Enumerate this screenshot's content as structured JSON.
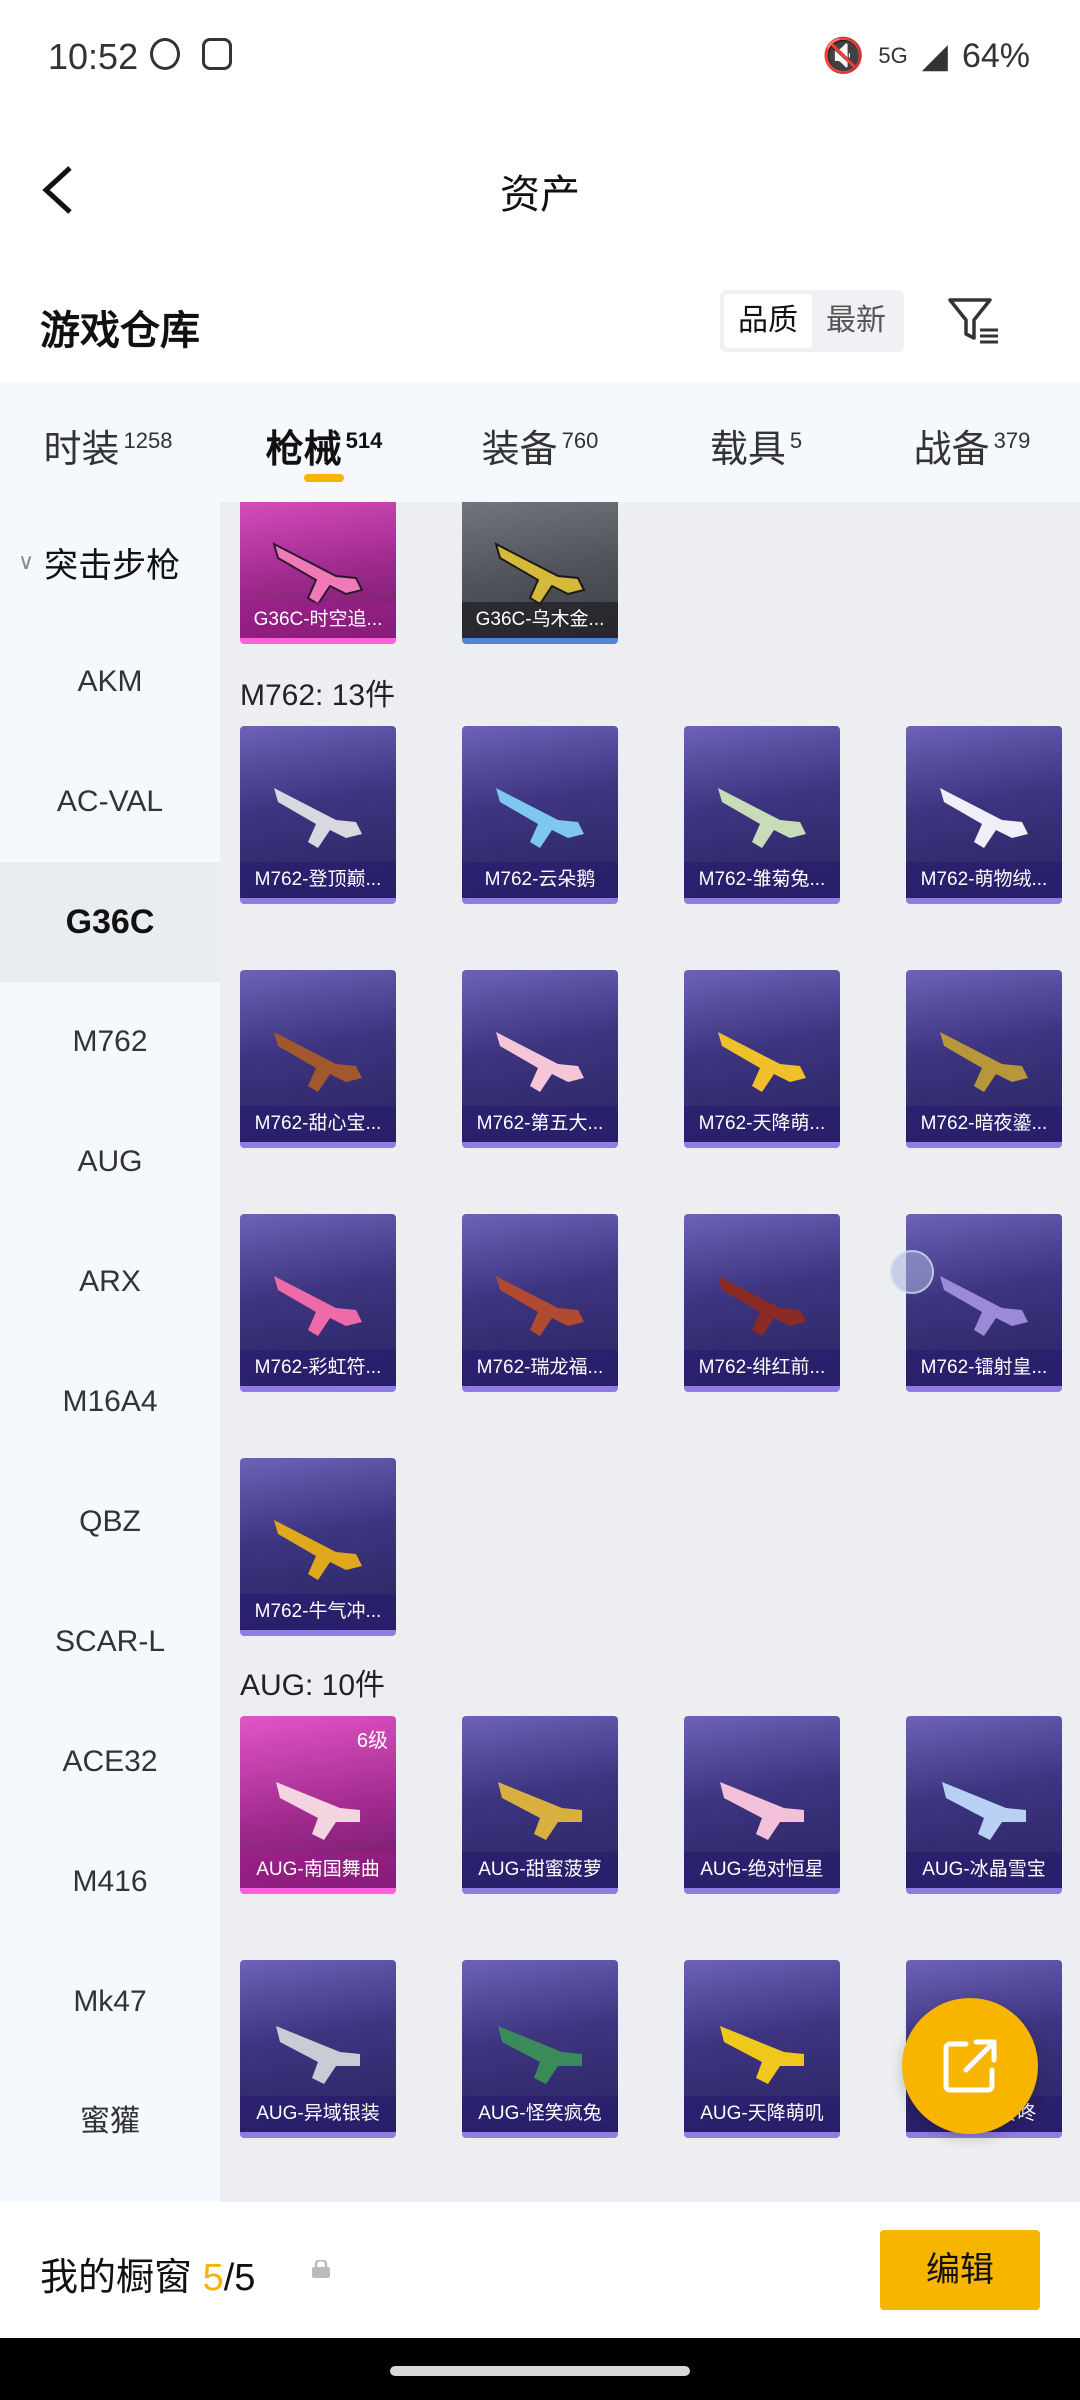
{
  "status": {
    "time": "10:52",
    "network": "5G",
    "battery": "64%"
  },
  "header": {
    "title": "资产"
  },
  "warehouse": {
    "title": "游戏仓库",
    "sort_options": [
      "品质",
      "最新"
    ]
  },
  "tabs": [
    {
      "label": "时装",
      "count": "1258"
    },
    {
      "label": "枪械",
      "count": "514"
    },
    {
      "label": "装备",
      "count": "760"
    },
    {
      "label": "载具",
      "count": "5"
    },
    {
      "label": "战备",
      "count": "379"
    }
  ],
  "sidebar": {
    "group": "突击步枪",
    "items": [
      "AKM",
      "AC-VAL",
      "G36C",
      "M762",
      "AUG",
      "ARX",
      "M16A4",
      "QBZ",
      "SCAR-L",
      "ACE32",
      "M416",
      "Mk47",
      "蜜獾"
    ]
  },
  "sections": [
    {
      "label": "",
      "items": [
        "G36C-时空追...",
        "G36C-乌木金..."
      ]
    },
    {
      "label": "M762: 13件",
      "items": [
        "M762-登顶巅...",
        "M762-云朵鹅",
        "M762-雏菊兔...",
        "M762-萌物绒...",
        "M762-甜心宝...",
        "M762-第五大...",
        "M762-天降萌...",
        "M762-暗夜鎏...",
        "M762-彩虹符...",
        "M762-瑞龙福...",
        "M762-绯红前...",
        "M762-镭射皇...",
        "M762-牛气冲..."
      ]
    },
    {
      "label": "AUG: 10件",
      "items": [
        "AUG-南国舞曲",
        "AUG-甜蜜菠萝",
        "AUG-绝对恒星",
        "AUG-冰晶雪宝",
        "AUG-异域银装",
        "AUG-怪笑疯兔",
        "AUG-天降萌叽",
        "AUG-咚咚咚"
      ]
    }
  ],
  "badges": {
    "aug_first_level": "6级"
  },
  "bottom": {
    "label": "我的橱窗",
    "count_current": "5",
    "count_sep": "/",
    "count_total": "5",
    "edit_label": "编辑"
  },
  "colors": {
    "accent": "#f7b500",
    "card_purple": "#3d3480",
    "card_pink": "#a22b8f"
  }
}
